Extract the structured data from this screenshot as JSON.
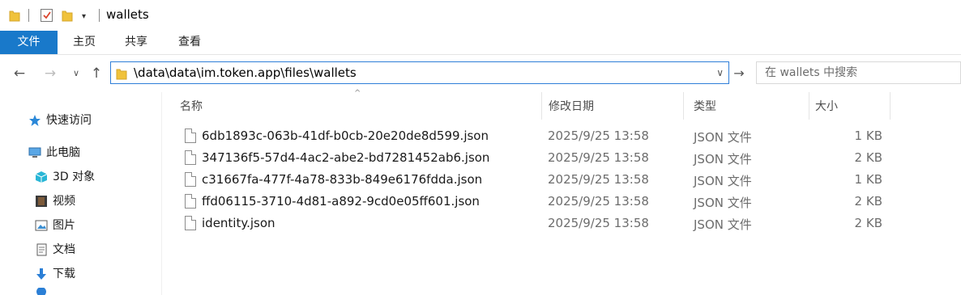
{
  "window": {
    "title": "wallets"
  },
  "ribbon": {
    "tabs": [
      {
        "label": "文件",
        "active": true
      },
      {
        "label": "主页"
      },
      {
        "label": "共享"
      },
      {
        "label": "查看"
      }
    ]
  },
  "nav": {
    "address_path": "\\data\\data\\im.token.app\\files\\wallets",
    "search_placeholder": "在 wallets 中搜索"
  },
  "sidebar": {
    "items": [
      {
        "label": "快速访问",
        "icon": "star-icon"
      },
      {
        "label": "此电脑",
        "icon": "computer-icon"
      },
      {
        "label": "3D 对象",
        "icon": "cube-icon"
      },
      {
        "label": "视频",
        "icon": "film-icon"
      },
      {
        "label": "图片",
        "icon": "picture-icon"
      },
      {
        "label": "文档",
        "icon": "document-icon"
      },
      {
        "label": "下载",
        "icon": "download-icon"
      }
    ]
  },
  "columns": {
    "name": "名称",
    "modified": "修改日期",
    "type": "类型",
    "size": "大小"
  },
  "files": [
    {
      "name": "6db1893c-063b-41df-b0cb-20e20de8d599.json",
      "modified": "2025/9/25 13:58",
      "type": "JSON 文件",
      "size": "1 KB"
    },
    {
      "name": "347136f5-57d4-4ac2-abe2-bd7281452ab6.json",
      "modified": "2025/9/25 13:58",
      "type": "JSON 文件",
      "size": "2 KB"
    },
    {
      "name": "c31667fa-477f-4a78-833b-849e6176fdda.json",
      "modified": "2025/9/25 13:58",
      "type": "JSON 文件",
      "size": "1 KB"
    },
    {
      "name": "ffd06115-3710-4d81-a892-9cd0e05ff601.json",
      "modified": "2025/9/25 13:58",
      "type": "JSON 文件",
      "size": "2 KB"
    },
    {
      "name": "identity.json",
      "modified": "2025/9/25 13:58",
      "type": "JSON 文件",
      "size": "2 KB"
    }
  ],
  "colors": {
    "accent": "#1979ca",
    "folder": "#f0c23b"
  }
}
